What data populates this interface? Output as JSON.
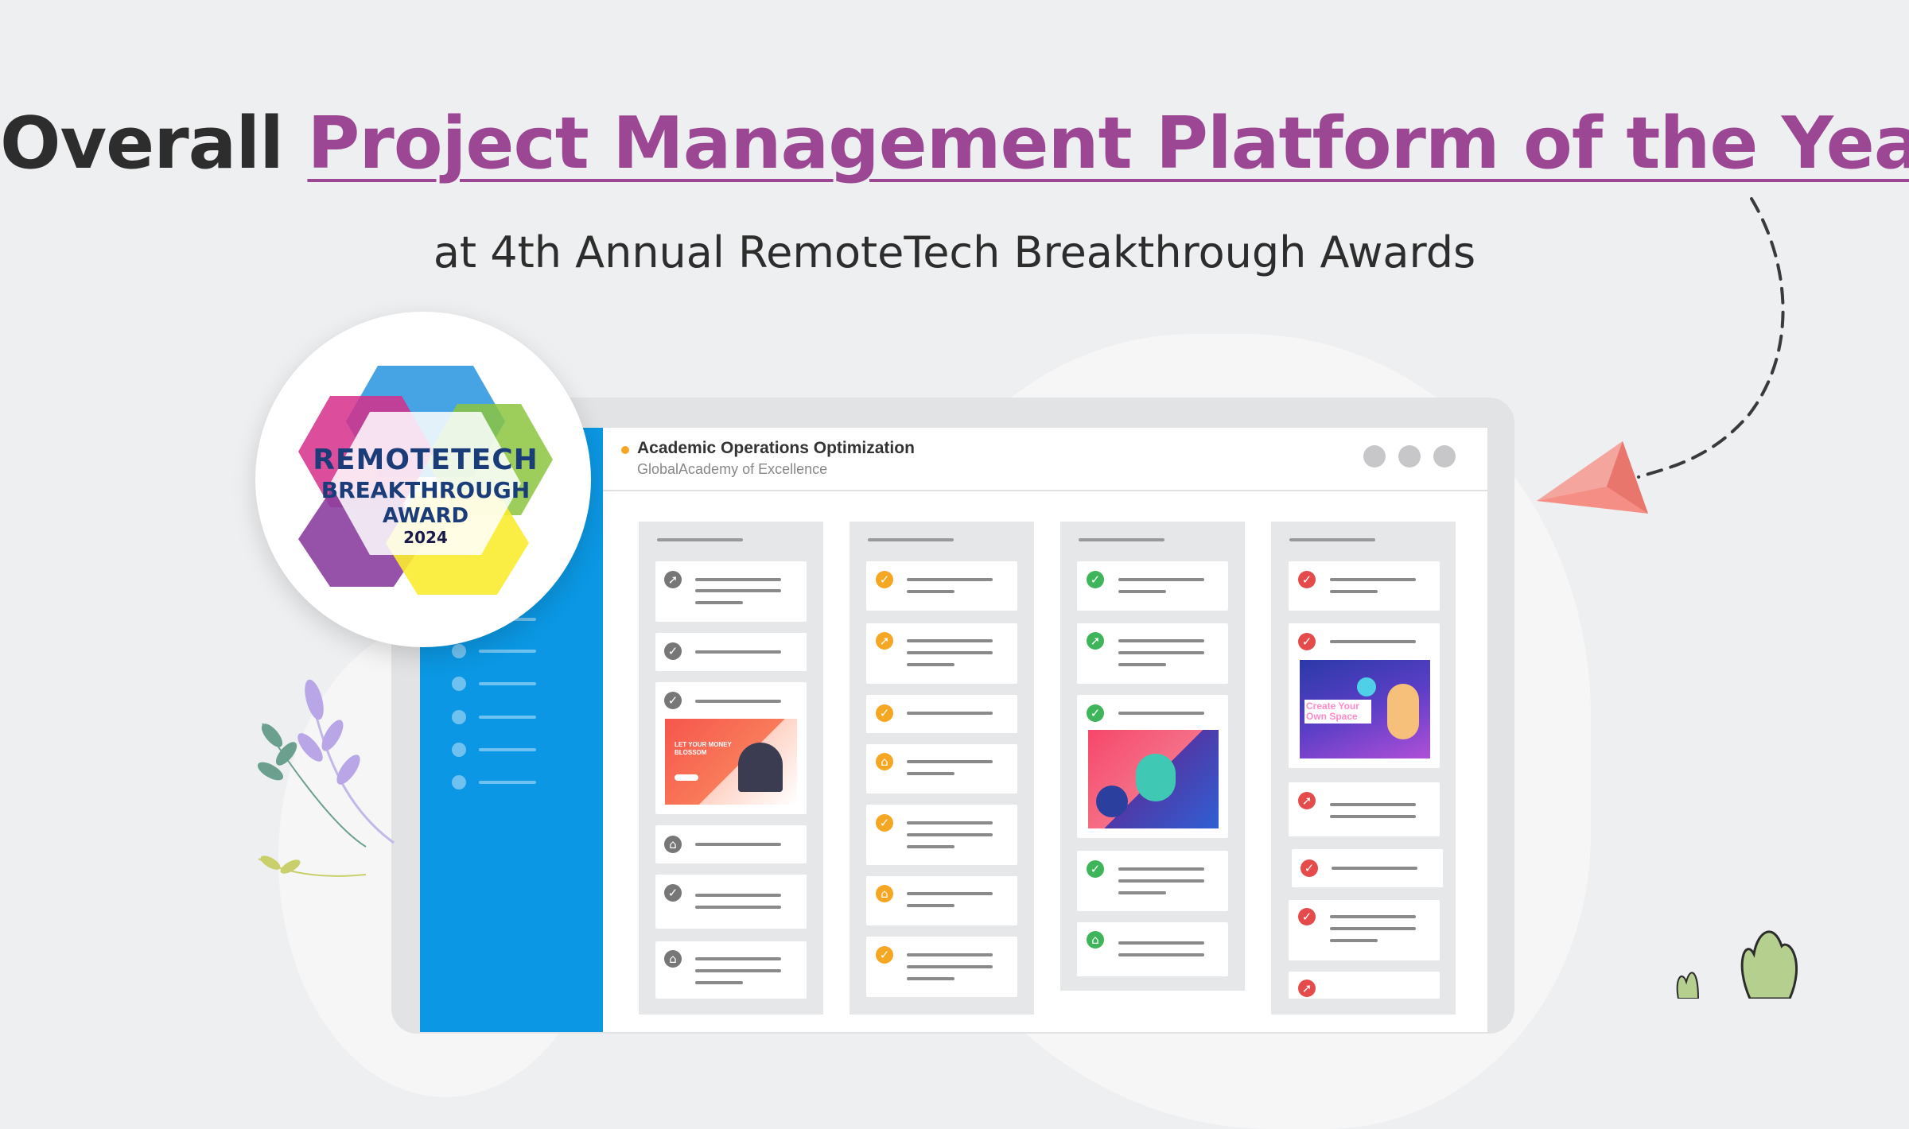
{
  "headline": {
    "prefix": "Overall",
    "highlight": "Project Management Platform of the Year"
  },
  "subline": {
    "prefix": "at",
    "event": "4th Annual RemoteTech Breakthrough Awards"
  },
  "badge": {
    "line1": "REMOTETECH",
    "line2": "BREAKTHROUGH",
    "line3": "AWARD",
    "year": "2024"
  },
  "app": {
    "project_title": "Academic Operations Optimization",
    "organization": "GlobalAcademy of Excellence"
  },
  "image_cards": {
    "col1_title": "LET YOUR MONEY BLOSSOM",
    "col4_title": "Create Your Own Space"
  },
  "colors": {
    "accent": "#9c4794",
    "sidebar": "#0b97e3",
    "status_gray": "#777777",
    "status_yellow": "#f5a623",
    "status_green": "#3fb55b",
    "status_red": "#e54b4b"
  }
}
